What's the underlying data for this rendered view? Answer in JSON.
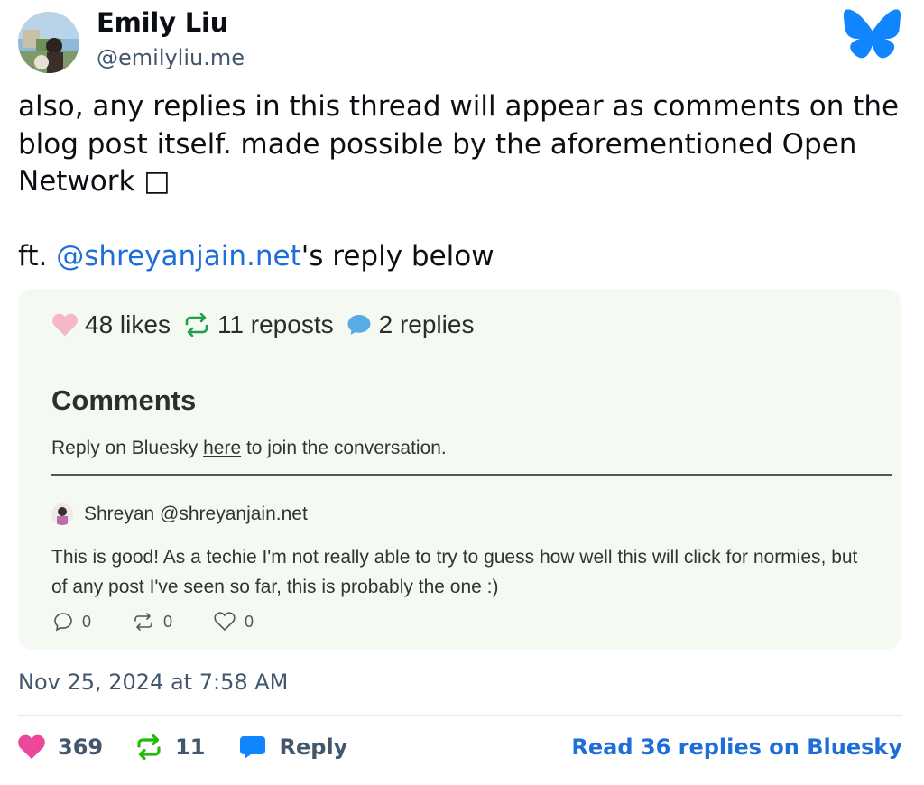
{
  "author": {
    "name": "Emily Liu",
    "handle": "@emilyliu.me"
  },
  "post": {
    "line1": "also, any replies in this thread will appear as comments on the blog post itself. made possible by the aforementioned Open Network □",
    "ft_prefix": "ft. ",
    "mention": "@shreyanjain.net",
    "ft_suffix": "'s reply below"
  },
  "embed": {
    "stats": {
      "likes": "48 likes",
      "reposts": "11 reposts",
      "replies": "2 replies"
    },
    "comments_title": "Comments",
    "reply_prompt_before": "Reply on Bluesky ",
    "reply_prompt_link": "here",
    "reply_prompt_after": " to join the conversation.",
    "comment": {
      "author": "Shreyan @shreyanjain.net",
      "text": "This is good! As a techie I'm not really able to try to guess how well this will click for normies, but of any post I've seen so far, this is probably the one :)",
      "replies": "0",
      "reposts": "0",
      "likes": "0"
    }
  },
  "timestamp": "Nov 25, 2024 at 7:58 AM",
  "footer": {
    "likes": "369",
    "reposts": "11",
    "reply_label": "Reply",
    "read_more": "Read 36 replies on Bluesky"
  },
  "colors": {
    "link": "#1d6ed8",
    "like": "#ec4899",
    "repost": "#20bc07",
    "reply": "#1185fe",
    "embed_bg": "#f4f9f1"
  },
  "icons": [
    "bluesky-butterfly-icon",
    "heart-icon",
    "repost-icon",
    "speech-bubble-icon"
  ]
}
